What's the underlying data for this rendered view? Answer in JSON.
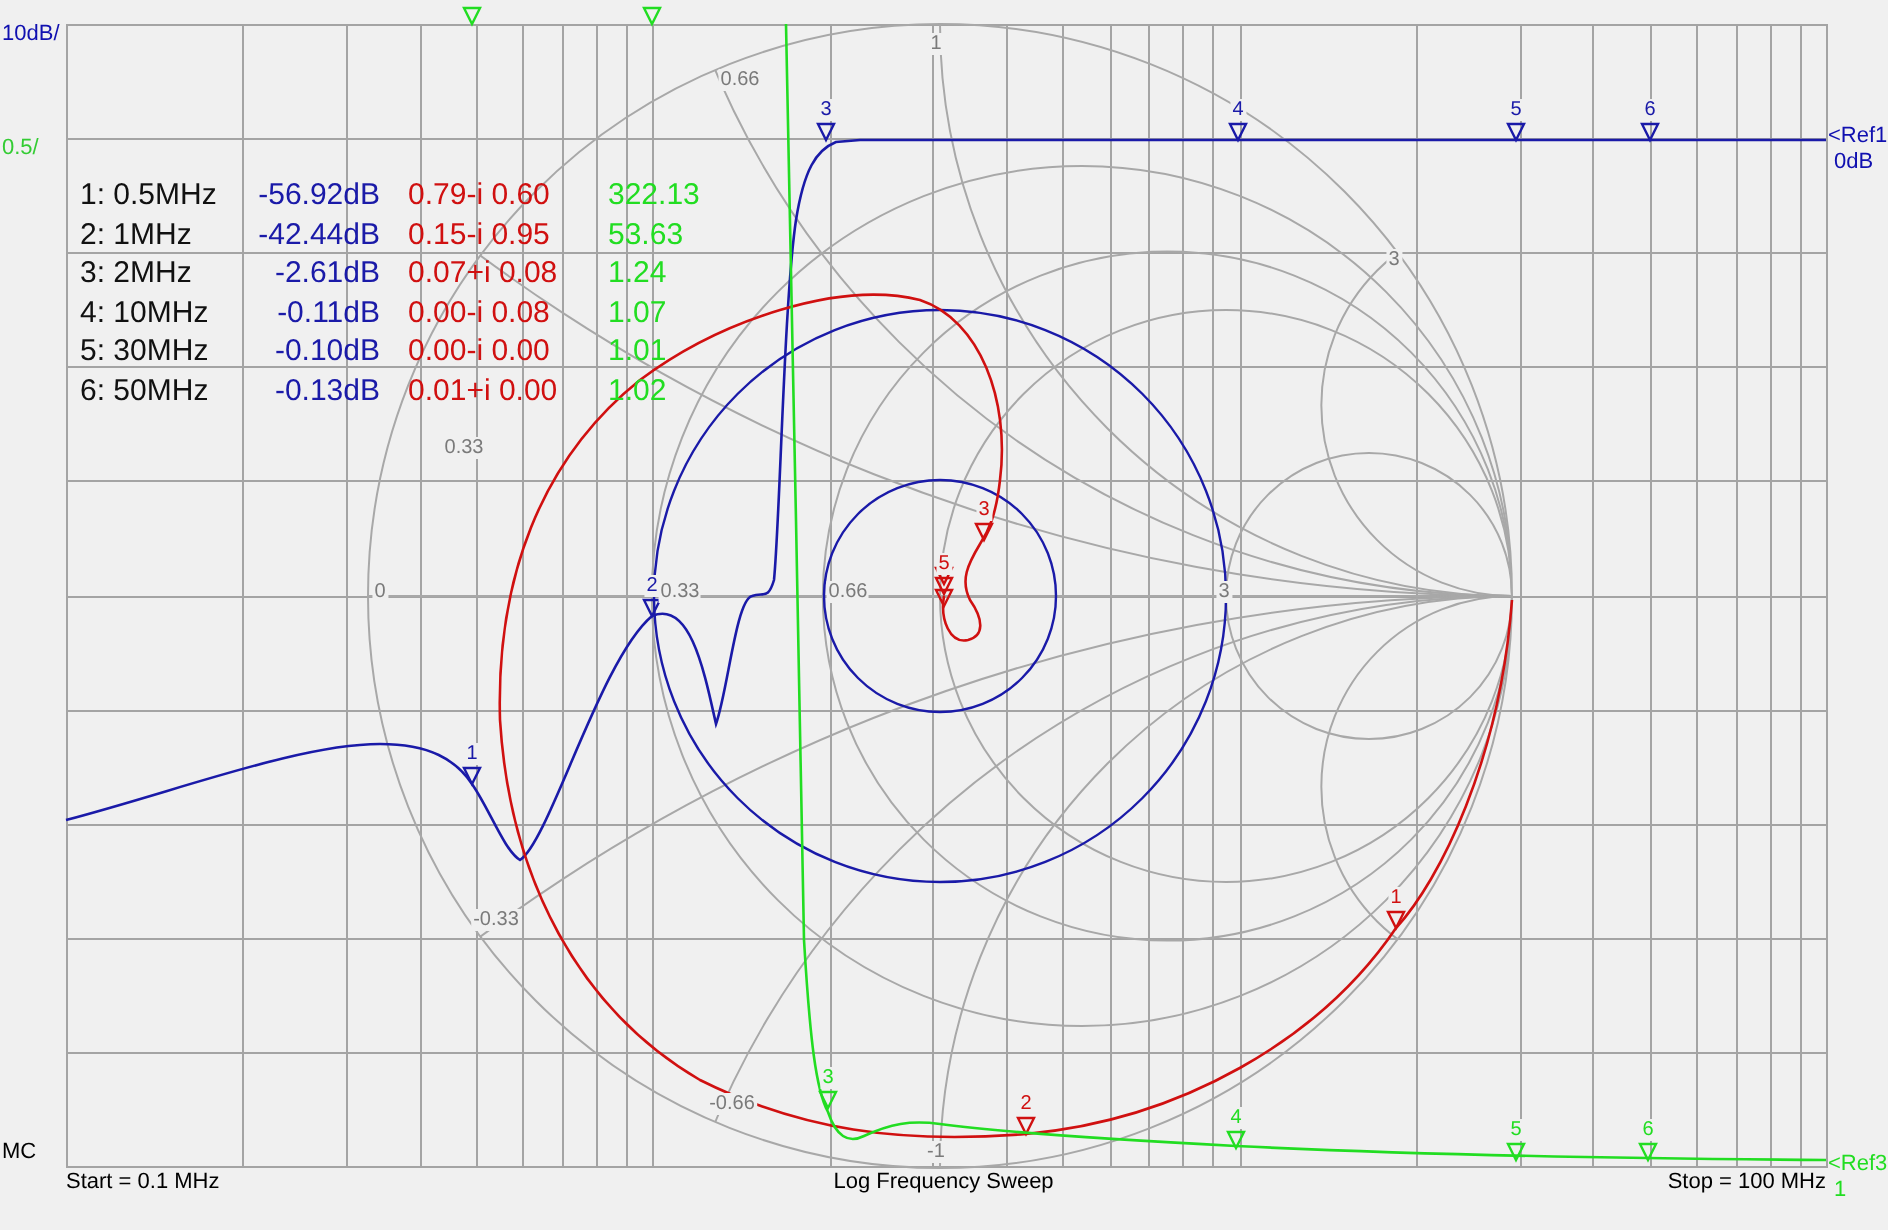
{
  "scale_labels": [
    {
      "text": "10dB/",
      "color": "#1010b0"
    },
    {
      "text": "0.5/",
      "color": "#33cc33"
    }
  ],
  "marker_table": [
    {
      "label": "1: 0.5MHz",
      "magnitude": "-56.92dB",
      "impedance": "0.79-i 0.60",
      "swr": "322.13"
    },
    {
      "label": "2: 1MHz",
      "magnitude": "-42.44dB",
      "impedance": "0.15-i 0.95",
      "swr": "53.63"
    },
    {
      "label": "3: 2MHz",
      "magnitude": "-2.61dB",
      "impedance": "0.07+i 0.08",
      "swr": "1.24"
    },
    {
      "label": "4: 10MHz",
      "magnitude": "-0.11dB",
      "impedance": "0.00-i 0.08",
      "swr": "1.07"
    },
    {
      "label": "5: 30MHz",
      "magnitude": "-0.10dB",
      "impedance": "0.00-i 0.00",
      "swr": "1.01"
    },
    {
      "label": "6: 50MHz",
      "magnitude": "-0.13dB",
      "impedance": "0.01+i 0.00",
      "swr": "1.02"
    }
  ],
  "traces": [
    {
      "kind": "log_magnitude",
      "color": "#1a1aa8",
      "markers": [
        {
          "label": "1",
          "off_scale": false
        },
        {
          "label": "2",
          "off_scale": false
        },
        {
          "label": "3",
          "off_scale": false
        },
        {
          "label": "4",
          "off_scale": false
        },
        {
          "label": "5",
          "off_scale": false
        },
        {
          "label": "6",
          "off_scale": false
        }
      ]
    },
    {
      "kind": "smith",
      "color": "#d01010",
      "markers": [
        {
          "label": "1",
          "off_scale": false
        },
        {
          "label": "2",
          "off_scale": false
        },
        {
          "label": "3",
          "off_scale": false
        },
        {
          "off_scale": false
        },
        {
          "label": "5",
          "off_scale": false
        },
        {
          "off_scale": false
        }
      ]
    },
    {
      "kind": "swr",
      "color": "#22dd22",
      "markers": [
        {
          "off_scale": true
        },
        {
          "off_scale": true
        },
        {
          "label": "3",
          "off_scale": false
        },
        {
          "label": "4",
          "off_scale": false
        },
        {
          "label": "5",
          "off_scale": false
        },
        {
          "label": "6",
          "off_scale": false
        }
      ]
    }
  ],
  "references": [
    {
      "text": "<Ref1",
      "value": "0dB",
      "color": "#1010b0"
    },
    {
      "text": "<Ref3",
      "value": "1",
      "color": "#22dd22"
    }
  ],
  "smith_labels": [
    "1",
    "0.66",
    "0.33",
    "3",
    "0",
    "0.33",
    "0.66",
    "3",
    "-0.33",
    "-0.66",
    "-1"
  ],
  "mode": "MC",
  "footer": {
    "start": "Start = 0.1 MHz",
    "sweep": "Log Frequency Sweep",
    "stop": "Stop = 100 MHz"
  }
}
